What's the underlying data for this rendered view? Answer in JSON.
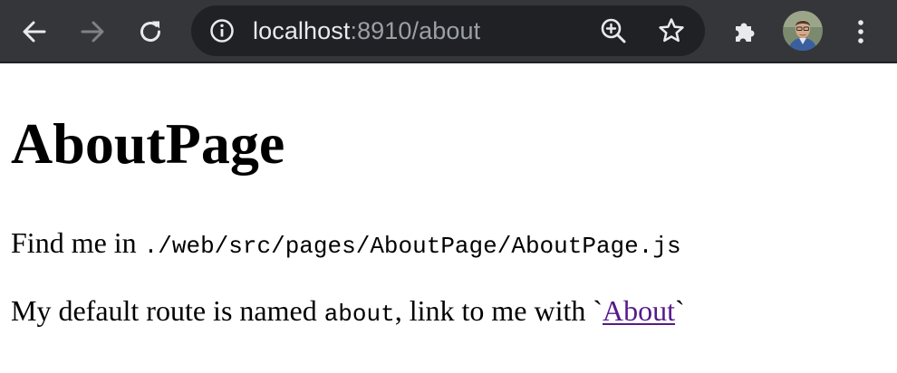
{
  "browser": {
    "back_icon": "arrow-left-icon",
    "forward_icon": "arrow-right-icon",
    "reload_icon": "reload-icon",
    "site_info_icon": "info-circle-icon",
    "address": {
      "host": "localhost",
      "rest": ":8910/about"
    },
    "zoom_icon": "zoom-in-icon",
    "bookmark_icon": "star-outline-icon",
    "extensions_icon": "puzzle-piece-icon",
    "menu_icon": "kebab-menu-icon",
    "colors": {
      "toolbar": "#35363a",
      "omnibox": "#202124",
      "icon_active": "#e8eaed",
      "icon_disabled": "#7e8185"
    }
  },
  "page": {
    "heading": "AboutPage",
    "paragraph1": {
      "text": "Find me in ",
      "code": "./web/src/pages/AboutPage/AboutPage.js"
    },
    "paragraph2": {
      "text_before": "My default route is named ",
      "code": "about",
      "text_middle": ", link to me with `",
      "link_label": "About",
      "text_after": "`"
    },
    "colors": {
      "visited_link": "#551a8b"
    }
  }
}
